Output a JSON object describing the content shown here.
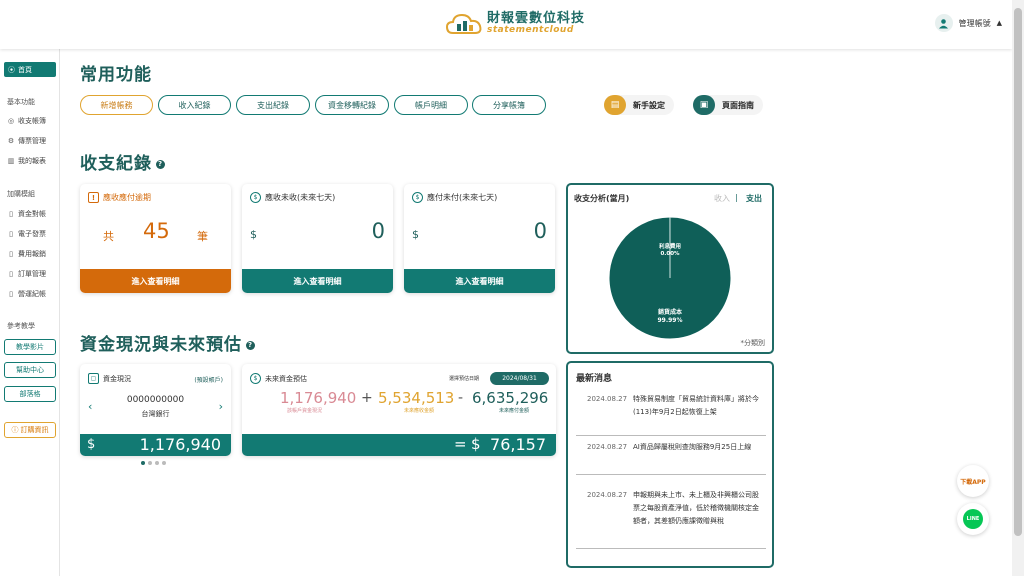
{
  "header": {
    "brand_cn": "財報雲數位科技",
    "brand_en": "statementcloud",
    "account_label": "管理帳號"
  },
  "sidebar": {
    "home": "首頁",
    "group_basic": "基本功能",
    "basic_items": [
      "收支帳簿",
      "傳票管理",
      "我的報表"
    ],
    "group_addon": "加購模組",
    "addon_items": [
      "資金對帳",
      "電子發票",
      "費用報銷",
      "訂單管理",
      "營運紀帳"
    ],
    "group_learn": "參考教學",
    "learn_buttons": [
      "教學影片",
      "幫助中心",
      "部落格"
    ],
    "order_info": "訂購資訊"
  },
  "common": {
    "title": "常用功能",
    "pills": [
      "新增帳務",
      "收入紀錄",
      "支出紀錄",
      "資金移轉紀錄",
      "帳戶明細",
      "分享帳簿"
    ],
    "setup_label": "新手設定",
    "guide_label": "頁面指南"
  },
  "records": {
    "title": "收支紀錄",
    "overdue": {
      "title": "應收應付逾期",
      "prefix": "共",
      "count": "45",
      "unit": "筆",
      "cta": "進入查看明細"
    },
    "receivable": {
      "title": "應收未收(未來七天)",
      "currency": "$",
      "amount": "0",
      "cta": "進入查看明細"
    },
    "payable": {
      "title": "應付未付(未來七天)",
      "currency": "$",
      "amount": "0",
      "cta": "進入查看明細"
    }
  },
  "analysis": {
    "title": "收支分析(當月)",
    "toggle_income": "收入",
    "divider": "|",
    "toggle_expense": "支出",
    "note": "*分類別"
  },
  "chart_data": {
    "type": "pie",
    "title": "收支分析(當月)",
    "slices": [
      {
        "label": "銷貨成本",
        "value": 99.99,
        "display": "99.99%"
      },
      {
        "label": "利息費用",
        "value": 0.01,
        "display": "0.00%"
      }
    ],
    "colors": [
      "#0f5f58",
      "#0f5f58"
    ]
  },
  "funds": {
    "title": "資金現況與未來預估",
    "cash": {
      "title": "資金現況",
      "tag": "(預設帳戶)",
      "account_no": "0000000000",
      "bank": "台灣銀行",
      "currency": "$",
      "amount": "1,176,940",
      "dots": 4
    },
    "forecast": {
      "title": "未來資金預估",
      "date_label": "選擇預估日期",
      "date": "2024/08/31",
      "current": "1,176,940",
      "current_label": "該帳戶資金現況",
      "plus": "+",
      "receivable": "5,534,513",
      "receivable_label": "未來應收金額",
      "minus": "-",
      "payable": "6,635,296",
      "payable_label": "未來應付金額",
      "equals": "=",
      "currency": "$",
      "result": "76,157"
    }
  },
  "news": {
    "title": "最新消息",
    "items": [
      {
        "date": "2024.08.27",
        "text": "特殊貿易制度「貿易統計資料庫」將於今(113)年9月2日起恢復上架"
      },
      {
        "date": "2024.08.27",
        "text": "AI資品歸屬稅則查詢服務9月25日上線"
      },
      {
        "date": "2024.08.27",
        "text": "申報期與未上市、未上櫃及非興櫃公司股票之每股資產淨值，低於稽徵機關核定金額者，其差額仍應課徵贈與稅"
      }
    ]
  },
  "floating": {
    "app_label": "下載APP",
    "line_label": "LINE"
  },
  "colors": {
    "primary": "#127a73",
    "dark_teal": "#1f5f5b",
    "orange": "#d46a0b",
    "gold": "#e0a430",
    "pink": "#d98a94"
  }
}
